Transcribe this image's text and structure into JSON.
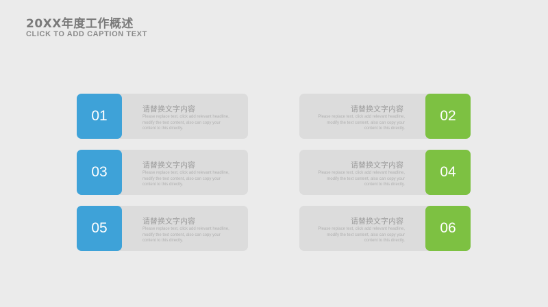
{
  "header": {
    "title": "20XX年度工作概述",
    "subtitle": "CLICK TO ADD CAPTION TEXT"
  },
  "colors": {
    "left_accent": "#3ea2d8",
    "right_accent": "#7dc142",
    "card": "#dcdcdc",
    "background": "#ebebeb"
  },
  "items": [
    {
      "number": "01",
      "heading": "请替换文字内容",
      "body": "Please replace text, click add relevant headline, modify the text content, also can copy your content to this directly."
    },
    {
      "number": "02",
      "heading": "请替换文字内容",
      "body": "Please replace text, click add relevant headline, modify the text content, also can copy your content to this directly."
    },
    {
      "number": "03",
      "heading": "请替换文字内容",
      "body": "Please replace text, click add relevant headline, modify the text content, also can copy your content to this directly."
    },
    {
      "number": "04",
      "heading": "请替换文字内容",
      "body": "Please replace text, click add relevant headline, modify the text content, also can copy your content to this directly."
    },
    {
      "number": "05",
      "heading": "请替换文字内容",
      "body": "Please replace text, click add relevant headline, modify the text content, also can copy your content to this directly."
    },
    {
      "number": "06",
      "heading": "请替换文字内容",
      "body": "Please replace text, click add relevant headline, modify the text content, also can copy your content to this directly."
    }
  ]
}
